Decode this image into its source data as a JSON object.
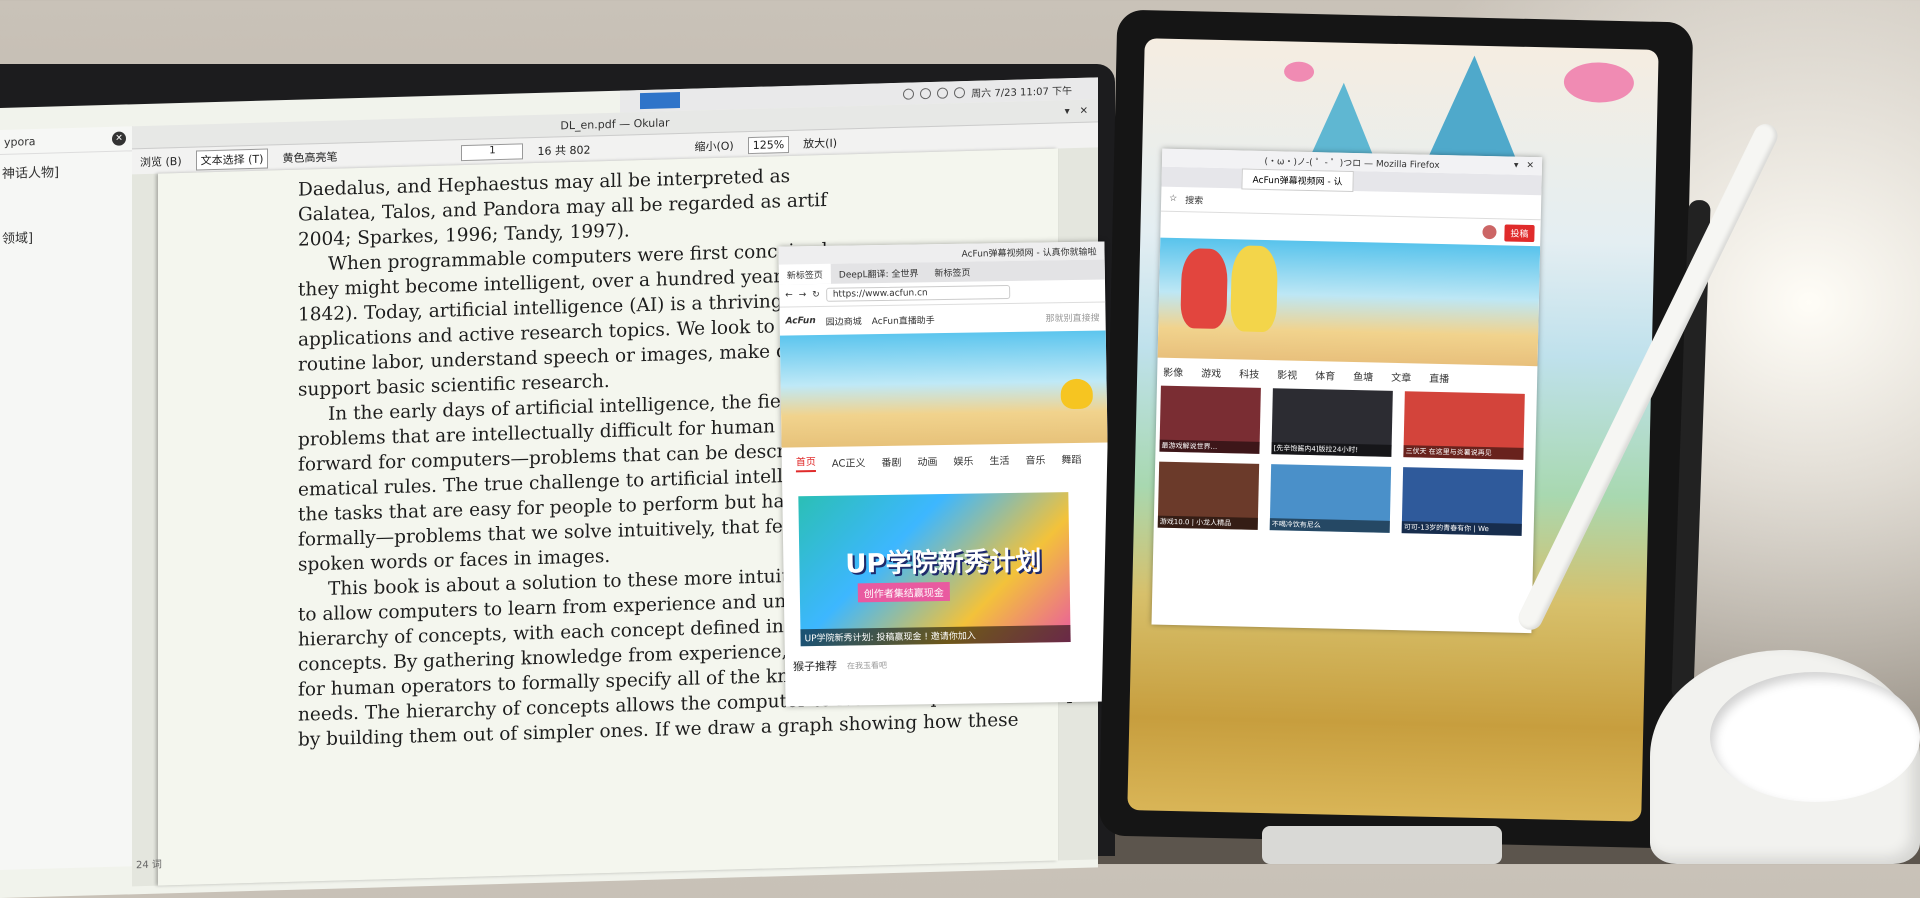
{
  "okular": {
    "window_title": "DL_en.pdf — Okular",
    "toolbar": {
      "browse": "浏览 (B)",
      "text_select": "文本选择 (T)",
      "highlighter": "黄色高亮笔",
      "page": "1",
      "page_count": "16  共 802",
      "shrink": "缩小(O)",
      "zoom": "125%",
      "enlarge": "放大(I)"
    },
    "paragraphs": [
      [
        "Daedalus, and Hephaestus may all be interpreted as"
      ],
      [
        "Galatea, Talos, and Pandora may all be regarded as artif"
      ],
      [
        "2004; Sparkes, 1996; Tandy, 1997)."
      ],
      [
        "When programmable computers were first conceived,"
      ],
      [
        "they might become intelligent, over a hundred years befo"
      ],
      [
        "1842). Today, artificial intelligence (AI) is a thriving"
      ],
      [
        "applications and active research topics. We look to intelli"
      ],
      [
        "routine labor, understand speech or images, make di"
      ],
      [
        "support basic scientific research."
      ],
      [
        "In the early days of artificial intelligence, the field r"
      ],
      [
        "problems that are intellectually difficult for human bein"
      ],
      [
        "forward for computers—problems that can be described"
      ],
      [
        "ematical rules. The true challenge to artificial intellige"
      ],
      [
        "the tasks that are easy for people to perform but har"
      ],
      [
        "formally—problems that we solve intuitively, that feel a"
      ],
      [
        "spoken words or faces in images."
      ],
      [
        "This book is about a solution to these more intuitive"
      ],
      [
        "to allow computers to learn from experience and underst"
      ],
      [
        "hierarchy of concepts, with each concept defined in term"
      ],
      [
        "concepts. By gathering knowledge from experience, this approach avoids the need"
      ],
      [
        "for human operators to formally specify all of the knowledge that the computer"
      ],
      [
        "needs. The hierarchy of concepts allows the computer to learn complicated concepts"
      ],
      [
        "by building them out of simpler ones. If we draw a graph showing how these"
      ]
    ]
  },
  "typora": {
    "title": "ypora",
    "items": [
      "神话人物]",
      "领域]"
    ],
    "word_count": "24 词"
  },
  "system_bar": {
    "datetime": "周六 7/23 11:07 下午"
  },
  "acfun": {
    "window_title": "AcFun弹幕视频网 - 认真你就输啦",
    "tabs": [
      "新标签页",
      "DeepL翻译: 全世界",
      "新标签页"
    ],
    "url": "https://www.acfun.cn",
    "logo": "AcFun",
    "links": [
      "园边商城",
      "AcFun直播助手"
    ],
    "search_placeholder": "那就别直接搜",
    "nav": [
      "首页",
      "AC正义",
      "番剧",
      "动画",
      "娱乐",
      "生活",
      "音乐",
      "舞蹈"
    ],
    "promo_title": "UP学院新秀计划",
    "promo_sub": "创作者集结赢现金",
    "promo_caption": "UP学院新秀计划: 投稿赢现金 ! 邀请你加入",
    "recommend": "猴子推荐",
    "recommend_more": "在我玉看吧"
  },
  "firefox": {
    "window_title": "(・ω・)ノ-( ゜- ゜)つロ — Mozilla Firefox",
    "tab": "AcFun弹幕视频网 - 认",
    "search": "搜索",
    "submit": "投稿",
    "nav": [
      "影像",
      "游戏",
      "科技",
      "影视",
      "体育",
      "鱼塘",
      "文章",
      "直播"
    ],
    "thumbs": [
      {
        "caption": "最游戏解说世界...",
        "color": "#7a2d33"
      },
      {
        "caption": "[先辛饱酱内4]版拉24小时!",
        "color": "#2c2c32"
      },
      {
        "caption": "三伏天 在这里与炎暑说再见",
        "color": "#d3443b"
      },
      {
        "caption": "游戏10.0 | 小龙人精品",
        "color": "#6b3a2a"
      },
      {
        "caption": "不喝冷饮有尼么",
        "color": "#4a90c9"
      },
      {
        "caption": "可可-13岁的青春有你 | We",
        "color": "#2f5a9b"
      }
    ]
  }
}
